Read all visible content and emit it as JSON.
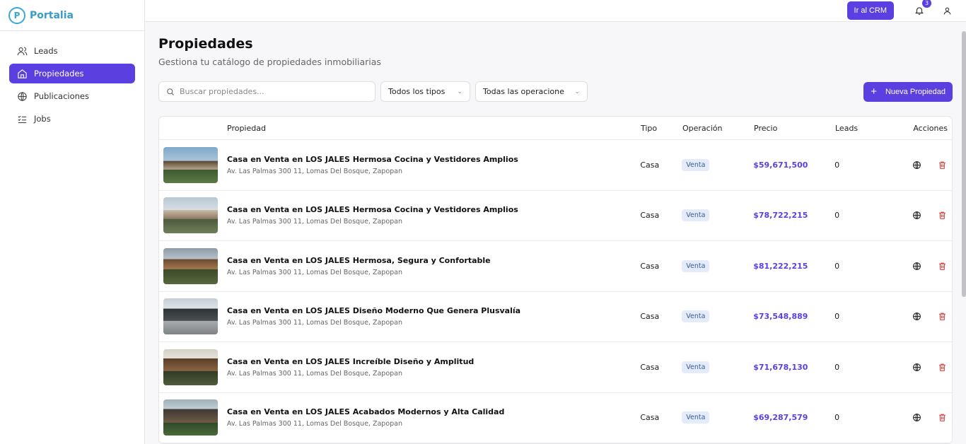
{
  "brand": {
    "name": "Portalia",
    "logo_letter": "P"
  },
  "sidebar": {
    "items": [
      {
        "label": "Leads",
        "icon": "users-icon",
        "active": false
      },
      {
        "label": "Propiedades",
        "icon": "home-icon",
        "active": true
      },
      {
        "label": "Publicaciones",
        "icon": "globe-icon",
        "active": false
      },
      {
        "label": "Jobs",
        "icon": "list-checks-icon",
        "active": false
      }
    ]
  },
  "topbar": {
    "crm_label": "Ir al CRM",
    "notification_count": "3"
  },
  "page": {
    "title": "Propiedades",
    "subtitle": "Gestiona tu catálogo de propiedades inmobiliarias"
  },
  "filters": {
    "search_placeholder": "Buscar propiedades...",
    "type_select": "Todos los tipos",
    "operation_select": "Todas las operacione",
    "new_label": "Nueva Propiedad"
  },
  "table": {
    "headers": {
      "property": "Propiedad",
      "type": "Tipo",
      "operation": "Operación",
      "price": "Precio",
      "leads": "Leads",
      "actions": "Acciones"
    },
    "rows": [
      {
        "title": "Casa en Venta en LOS JALES Hermosa Cocina y Vestidores Amplios",
        "address": "Av. Las Palmas 300 11, Lomas Del Bosque, Zapopan",
        "type": "Casa",
        "operation": "Venta",
        "price": "$59,671,500",
        "leads": "0"
      },
      {
        "title": "Casa en Venta en LOS JALES Hermosa Cocina y Vestidores Amplios",
        "address": "Av. Las Palmas 300 11, Lomas Del Bosque, Zapopan",
        "type": "Casa",
        "operation": "Venta",
        "price": "$78,722,215",
        "leads": "0"
      },
      {
        "title": "Casa en Venta en LOS JALES Hermosa, Segura y Confortable",
        "address": "Av. Las Palmas 300 11, Lomas Del Bosque, Zapopan",
        "type": "Casa",
        "operation": "Venta",
        "price": "$81,222,215",
        "leads": "0"
      },
      {
        "title": "Casa en Venta en LOS JALES Diseño Moderno Que Genera Plusvalía",
        "address": "Av. Las Palmas 300 11, Lomas Del Bosque, Zapopan",
        "type": "Casa",
        "operation": "Venta",
        "price": "$73,548,889",
        "leads": "0"
      },
      {
        "title": "Casa en Venta en LOS JALES Increíble Diseño y Amplitud",
        "address": "Av. Las Palmas 300 11, Lomas Del Bosque, Zapopan",
        "type": "Casa",
        "operation": "Venta",
        "price": "$71,678,130",
        "leads": "0"
      },
      {
        "title": "Casa en Venta en LOS JALES Acabados Modernos y Alta Calidad",
        "address": "Av. Las Palmas 300 11, Lomas Del Bosque, Zapopan",
        "type": "Casa",
        "operation": "Venta",
        "price": "$69,287,579",
        "leads": "0"
      }
    ]
  },
  "colors": {
    "accent": "#5b3fe0",
    "brand": "#3a9cc7",
    "delete": "#d93a3a"
  }
}
